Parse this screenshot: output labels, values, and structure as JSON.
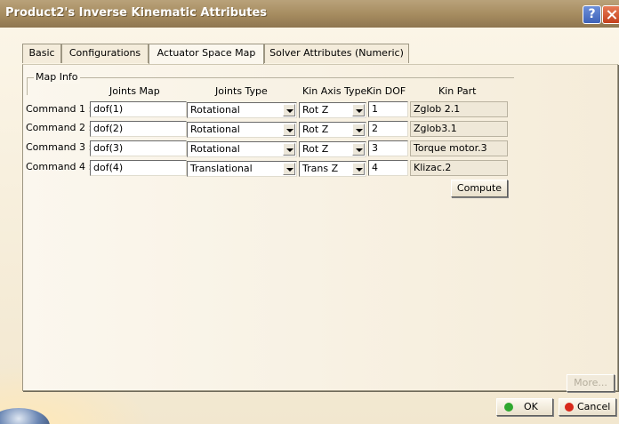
{
  "window": {
    "title": "Product2's Inverse Kinematic Attributes",
    "help_glyph": "?"
  },
  "tabs": [
    {
      "label": "Basic",
      "active": false
    },
    {
      "label": "Configurations",
      "active": false
    },
    {
      "label": "Actuator Space Map",
      "active": true
    },
    {
      "label": "Solver Attributes (Numeric)",
      "active": false
    }
  ],
  "map_info": {
    "group_label": "Map Info",
    "headers": {
      "joints_map": "Joints Map",
      "joints_type": "Joints Type",
      "kin_axis_type": "Kin Axis Type",
      "kin_dof": "Kin DOF",
      "kin_part": "Kin Part"
    },
    "rows": [
      {
        "label": "Command 1 :",
        "joints_map": "dof(1)",
        "joints_type": "Rotational",
        "kin_axis_type": "Rot Z",
        "kin_dof": "1",
        "kin_part": "Zglob 2.1"
      },
      {
        "label": "Command 2 :",
        "joints_map": "dof(2)",
        "joints_type": "Rotational",
        "kin_axis_type": "Rot Z",
        "kin_dof": "2",
        "kin_part": "Zglob3.1"
      },
      {
        "label": "Command 3 :",
        "joints_map": "dof(3)",
        "joints_type": "Rotational",
        "kin_axis_type": "Rot Z",
        "kin_dof": "3",
        "kin_part": "Torque motor.3"
      },
      {
        "label": "Command 4 :",
        "joints_map": "dof(4)",
        "joints_type": "Translational",
        "kin_axis_type": "Trans Z",
        "kin_dof": "4",
        "kin_part": "Klizac.2"
      }
    ],
    "compute_label": "Compute"
  },
  "footer": {
    "more_label": "More...",
    "ok_label": "OK",
    "cancel_label": "Cancel"
  },
  "colors": {
    "ok_dot": "#2fa82f",
    "cancel_dot": "#d8281a"
  }
}
